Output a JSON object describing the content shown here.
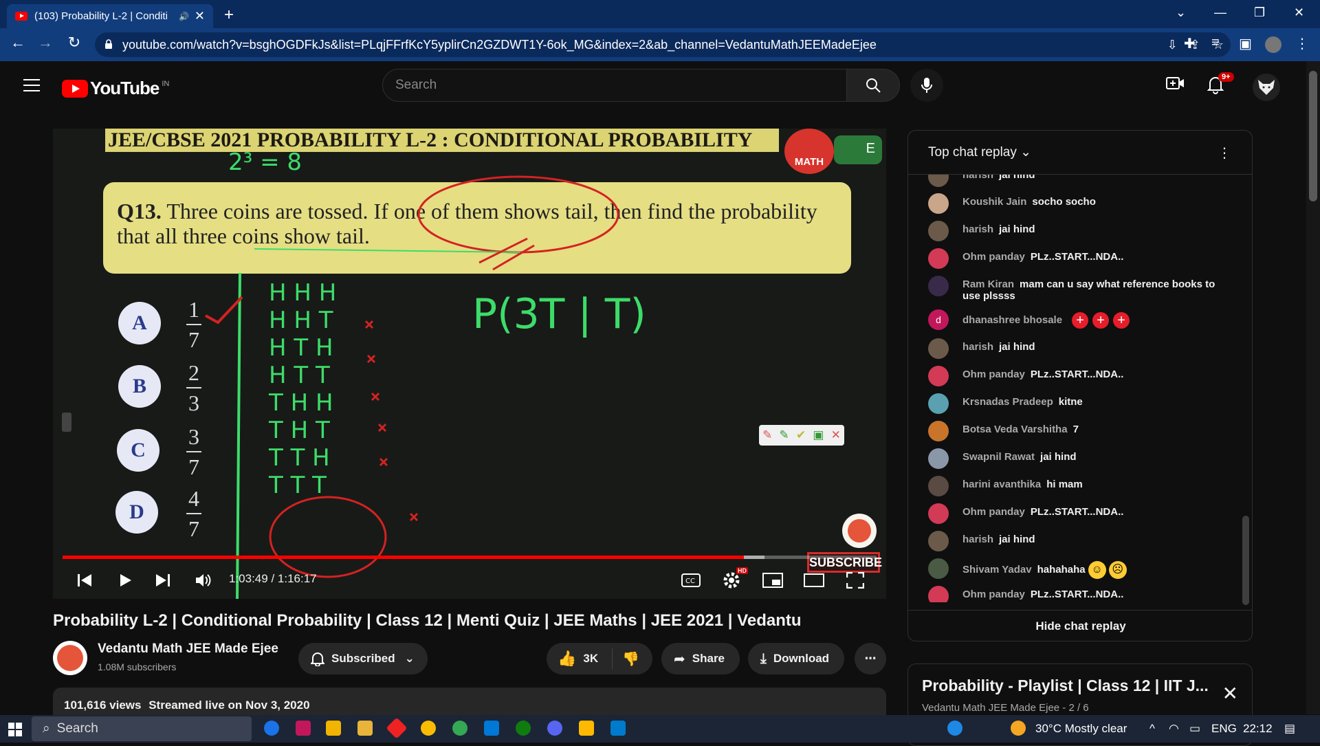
{
  "browser": {
    "tab_title": "(103) Probability L-2 | Conditi",
    "url": "youtube.com/watch?v=bsghOGDFkJs&list=PLqjFFrfKcY5yplirCn2GZDWT1Y-6ok_MG&index=2&ab_channel=VedantuMathJEEMadeEjee"
  },
  "header": {
    "logo_text": "YouTube",
    "country_code": "IN",
    "search_placeholder": "Search",
    "notification_badge": "9+"
  },
  "video": {
    "board_title": "JEE/CBSE 2021 PROBABILITY L-2 : CONDITIONAL PROBABILITY",
    "brand_badge": "MATH",
    "toggle_letter": "E",
    "question_number": "Q13.",
    "question_text": "Three coins are tossed. If one of them shows tail, then find the probability that all three coins show tail.",
    "options": [
      {
        "letter": "A",
        "num": "1",
        "den": "7"
      },
      {
        "letter": "B",
        "num": "2",
        "den": "3"
      },
      {
        "letter": "C",
        "num": "3",
        "den": "7"
      },
      {
        "letter": "D",
        "num": "4",
        "den": "7"
      }
    ],
    "handwriting": {
      "power": "2³ = 8",
      "formula": "P(3T | T)",
      "outcomes": [
        "H H H",
        "H H T",
        "H T H",
        "H T T",
        "T H H",
        "T H T",
        "T T H",
        "T T T"
      ]
    },
    "watermark_subscribe": "SUBSCRIBE",
    "time_current": "1:03:49",
    "time_total": "1:16:17",
    "progress_fraction": 0.837,
    "buffer_fraction": 0.862,
    "hd_label": "HD"
  },
  "meta": {
    "title": "Probability L-2 | Conditional Probability | Class 12 | Menti Quiz | JEE Maths | JEE 2021 | Vedantu",
    "channel_name": "Vedantu Math JEE Made Ejee",
    "subscribers": "1.08M subscribers",
    "subscribed_label": "Subscribed",
    "likes": "3K",
    "share_label": "Share",
    "download_label": "Download",
    "views": "101,616 views",
    "streamed": "Streamed live on Nov 3, 2020"
  },
  "chat": {
    "header": "Top chat replay",
    "footer": "Hide chat replay",
    "messages": [
      {
        "author": "harish",
        "text": "jai hind",
        "color": "#6b5a4a"
      },
      {
        "author": "Koushik Jain",
        "text": "socho socho",
        "color": "#c9a58a"
      },
      {
        "author": "harish",
        "text": "jai hind",
        "color": "#6b5a4a"
      },
      {
        "author": "Ohm panday",
        "text": "PLz..START...NDA..",
        "color": "#d23a55"
      },
      {
        "author": "Ram Kiran",
        "text": "mam can u say what reference books to use plssss",
        "color": "#3a2a4a"
      },
      {
        "author": "dhanashree bhosale",
        "text": "",
        "color": "#c2185b",
        "initial": "d",
        "hearts": 3
      },
      {
        "author": "harish",
        "text": "jai hind",
        "color": "#6b5a4a"
      },
      {
        "author": "Ohm panday",
        "text": "PLz..START...NDA..",
        "color": "#d23a55"
      },
      {
        "author": "Krsnadas Pradeep",
        "text": "kitne",
        "color": "#5aa0b0"
      },
      {
        "author": "Botsa Veda Varshitha",
        "text": "7",
        "color": "#c8742a"
      },
      {
        "author": "Swapnil Rawat",
        "text": "jai hind",
        "color": "#8a97a8"
      },
      {
        "author": "harini avanthika",
        "text": "hi mam",
        "color": "#5a4a44"
      },
      {
        "author": "Ohm panday",
        "text": "PLz..START...NDA..",
        "color": "#d23a55"
      },
      {
        "author": "harish",
        "text": "jai hind",
        "color": "#6b5a4a"
      },
      {
        "author": "Shivam Yadav",
        "text": "hahahaha",
        "color": "#4a5a44",
        "emojis": 2
      },
      {
        "author": "Ohm panday",
        "text": "PLz..START...NDA..",
        "color": "#d23a55"
      }
    ]
  },
  "playlist": {
    "title": "Probability - Playlist | Class 12 | IIT J...",
    "subtitle": "Vedantu Math JEE Made Ejee - 2 / 6"
  },
  "taskbar": {
    "search_label": "Search",
    "weather": "30°C  Mostly clear",
    "language": "ENG",
    "clock": "22:12"
  },
  "colors": {
    "accent_red": "#ff0000",
    "browser_blue": "#123d7d",
    "board_yellow": "#e5de83",
    "chalk_green": "#3ddc6a"
  }
}
